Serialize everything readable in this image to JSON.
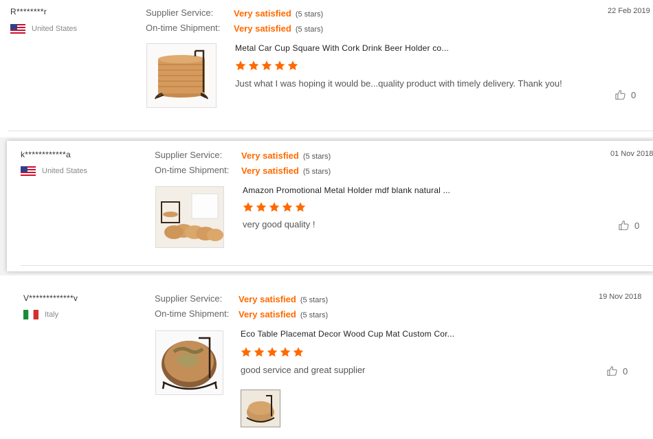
{
  "colors": {
    "accent": "#ff6a00",
    "star": "#ff6a00"
  },
  "labels": {
    "supplier_service": "Supplier Service:",
    "ontime_shipment": "On-time Shipment:"
  },
  "reviews": [
    {
      "buyer": "R********r",
      "country": "United States",
      "flag_icon": "us-flag-icon",
      "supplier_rating": "Very satisfied",
      "supplier_stars": "(5 stars)",
      "shipment_rating": "Very satisfied",
      "shipment_stars": "(5 stars)",
      "date": "22 Feb 2019",
      "product_title": "Metal Car Cup Square With Cork Drink Beer Holder co...",
      "star_count": 5,
      "feedback": "Just what I was hoping it would be...quality product with timely delivery. Thank you!",
      "likes": "0"
    },
    {
      "buyer": "k************a",
      "country": "United States",
      "flag_icon": "us-flag-icon",
      "supplier_rating": "Very satisfied",
      "supplier_stars": "(5 stars)",
      "shipment_rating": "Very satisfied",
      "shipment_stars": "(5 stars)",
      "date": "01 Nov 2018",
      "product_title": "Amazon Promotional Metal Holder mdf blank natural ...",
      "star_count": 5,
      "feedback": "very good quality !",
      "likes": "0"
    },
    {
      "buyer": "V*************v",
      "country": "Italy",
      "flag_icon": "italy-flag-icon",
      "supplier_rating": "Very satisfied",
      "supplier_stars": "(5 stars)",
      "shipment_rating": "Very satisfied",
      "shipment_stars": "(5 stars)",
      "date": "19 Nov 2018",
      "product_title": "Eco Table Placemat Decor Wood Cup Mat Custom Cor...",
      "star_count": 5,
      "feedback": "good service and great supplier",
      "likes": "0"
    }
  ]
}
